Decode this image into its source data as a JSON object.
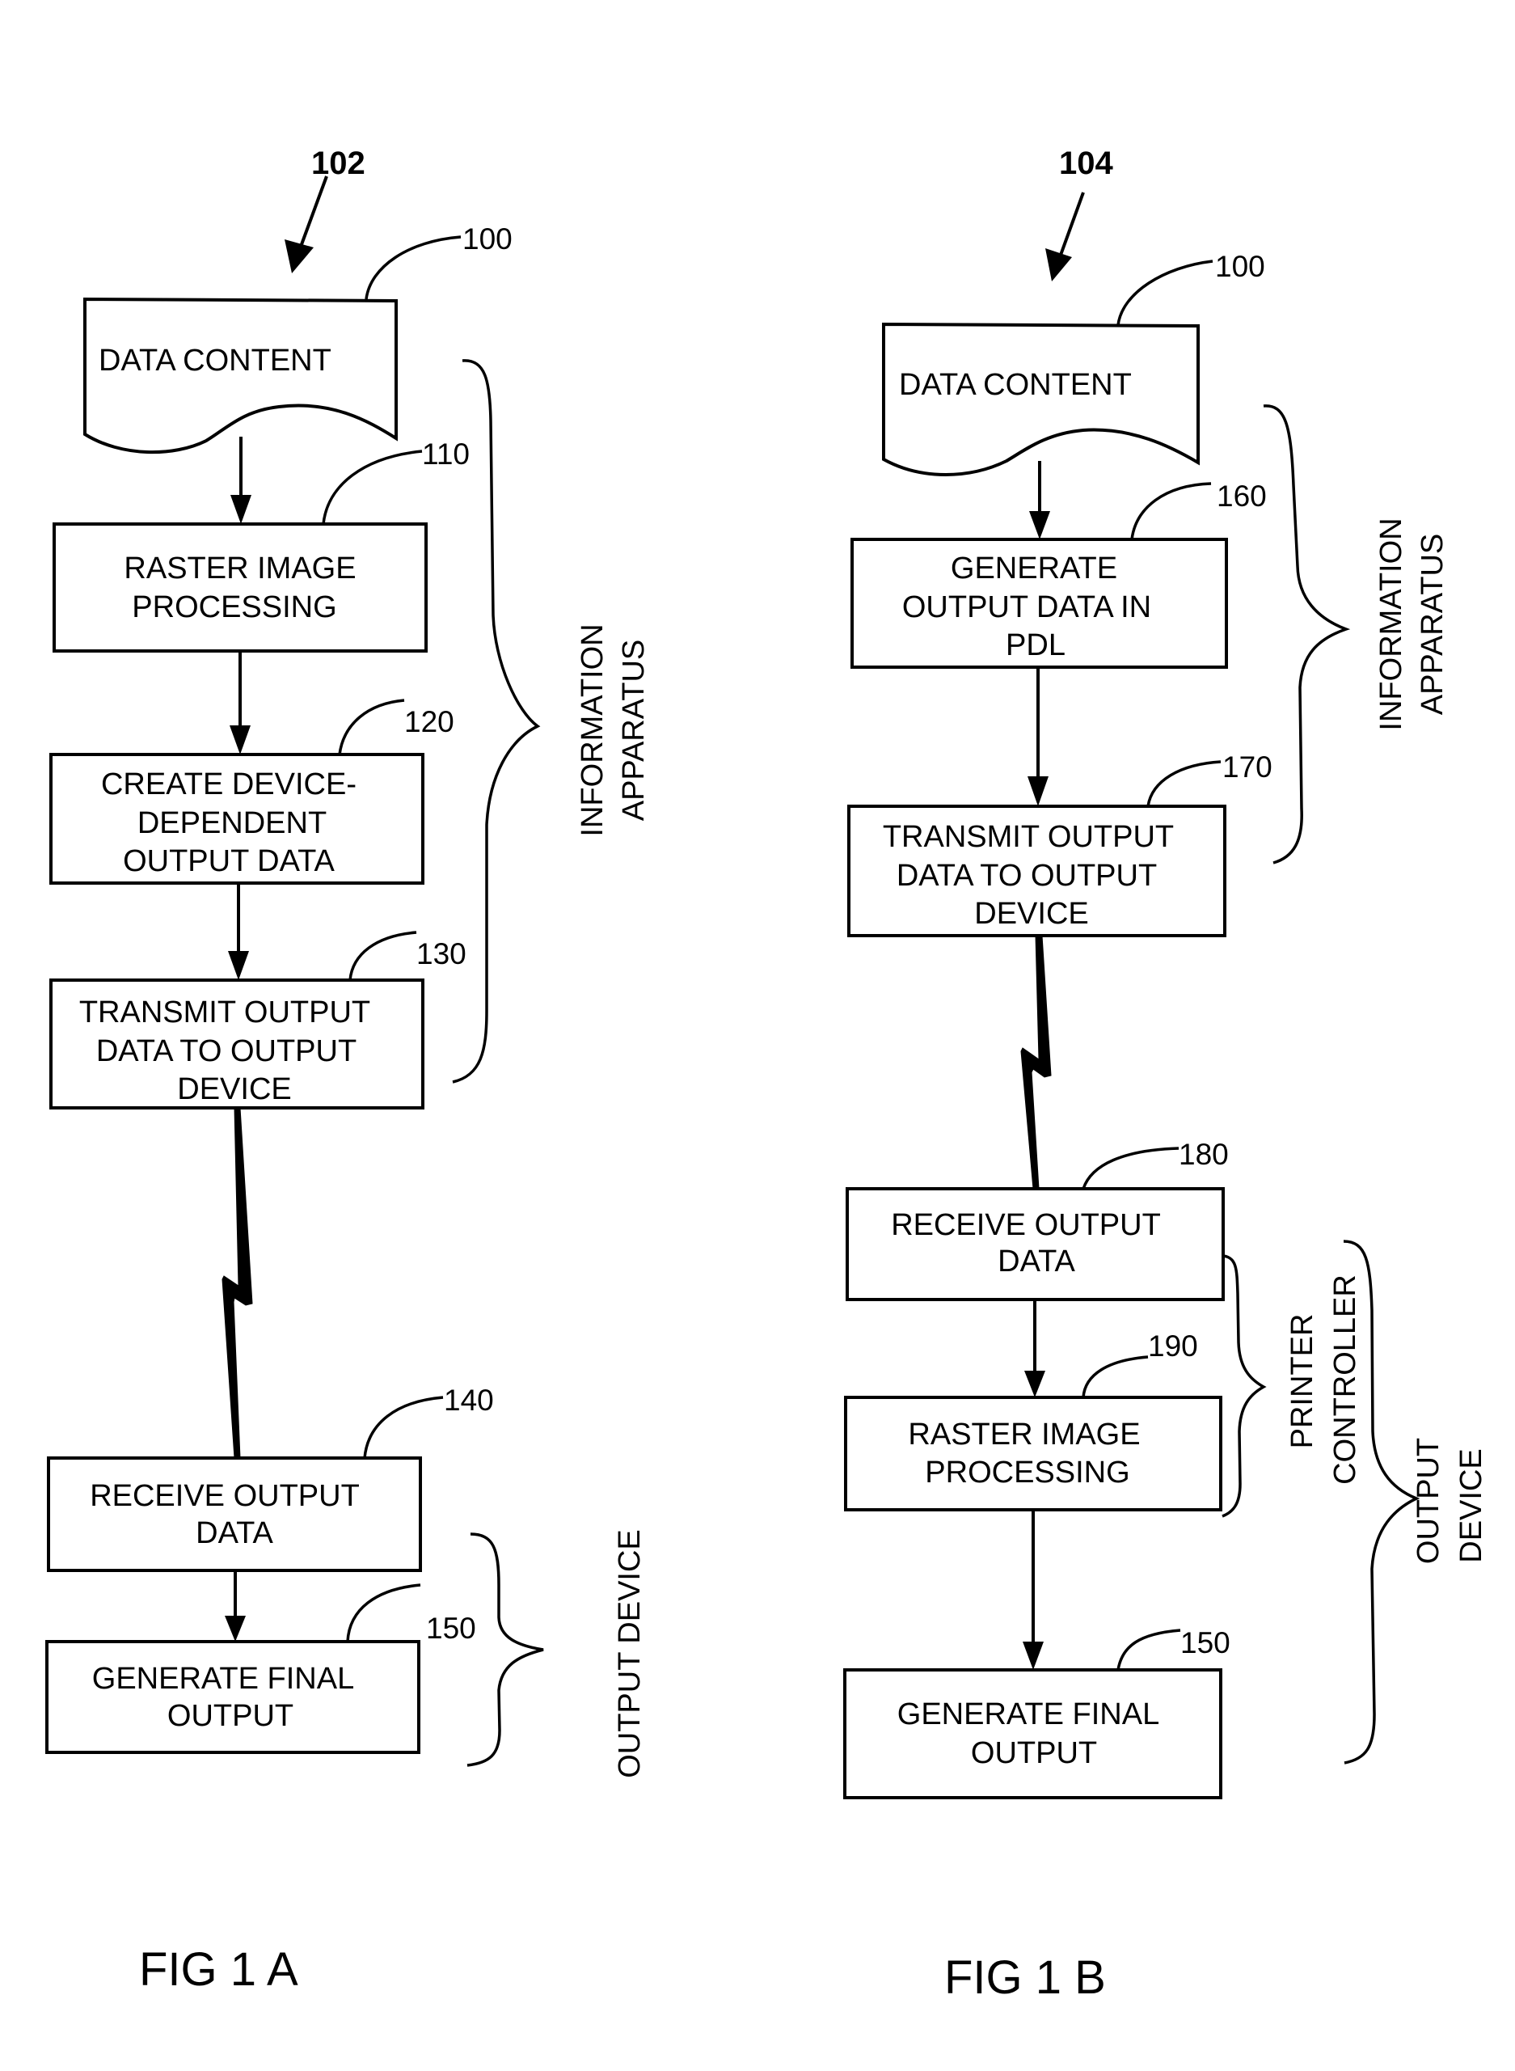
{
  "figures": {
    "fig_a": {
      "caption": "FIG 1 A",
      "ref": "102",
      "doc": {
        "ref": "100",
        "label": "DATA CONTENT"
      },
      "steps": [
        {
          "ref": "110",
          "lines": [
            "RASTER IMAGE",
            "PROCESSING"
          ]
        },
        {
          "ref": "120",
          "lines": [
            "CREATE DEVICE-",
            "DEPENDENT",
            "OUTPUT DATA"
          ]
        },
        {
          "ref": "130",
          "lines": [
            "TRANSMIT OUTPUT",
            "DATA TO OUTPUT",
            "DEVICE"
          ]
        },
        {
          "ref": "140",
          "lines": [
            "RECEIVE OUTPUT",
            "DATA"
          ]
        },
        {
          "ref": "150",
          "lines": [
            "GENERATE FINAL",
            "OUTPUT"
          ]
        }
      ],
      "groups": [
        {
          "lines": [
            "INFORMATION",
            "APPARATUS"
          ]
        },
        {
          "lines": [
            "OUTPUT DEVICE"
          ]
        }
      ]
    },
    "fig_b": {
      "caption": "FIG 1 B",
      "ref": "104",
      "doc": {
        "ref": "100",
        "label": "DATA CONTENT"
      },
      "steps": [
        {
          "ref": "160",
          "lines": [
            "GENERATE",
            "OUTPUT DATA IN",
            "PDL"
          ]
        },
        {
          "ref": "170",
          "lines": [
            "TRANSMIT OUTPUT",
            "DATA TO OUTPUT",
            "DEVICE"
          ]
        },
        {
          "ref": "180",
          "lines": [
            "RECEIVE OUTPUT",
            "DATA"
          ]
        },
        {
          "ref": "190",
          "lines": [
            "RASTER IMAGE",
            "PROCESSING"
          ]
        },
        {
          "ref": "150",
          "lines": [
            "GENERATE FINAL",
            "OUTPUT"
          ]
        }
      ],
      "groups": [
        {
          "lines": [
            "INFORMATION",
            "APPARATUS"
          ]
        },
        {
          "lines": [
            "PRINTER",
            "CONTROLLER"
          ]
        },
        {
          "lines": [
            "OUTPUT",
            "DEVICE"
          ]
        }
      ]
    }
  }
}
